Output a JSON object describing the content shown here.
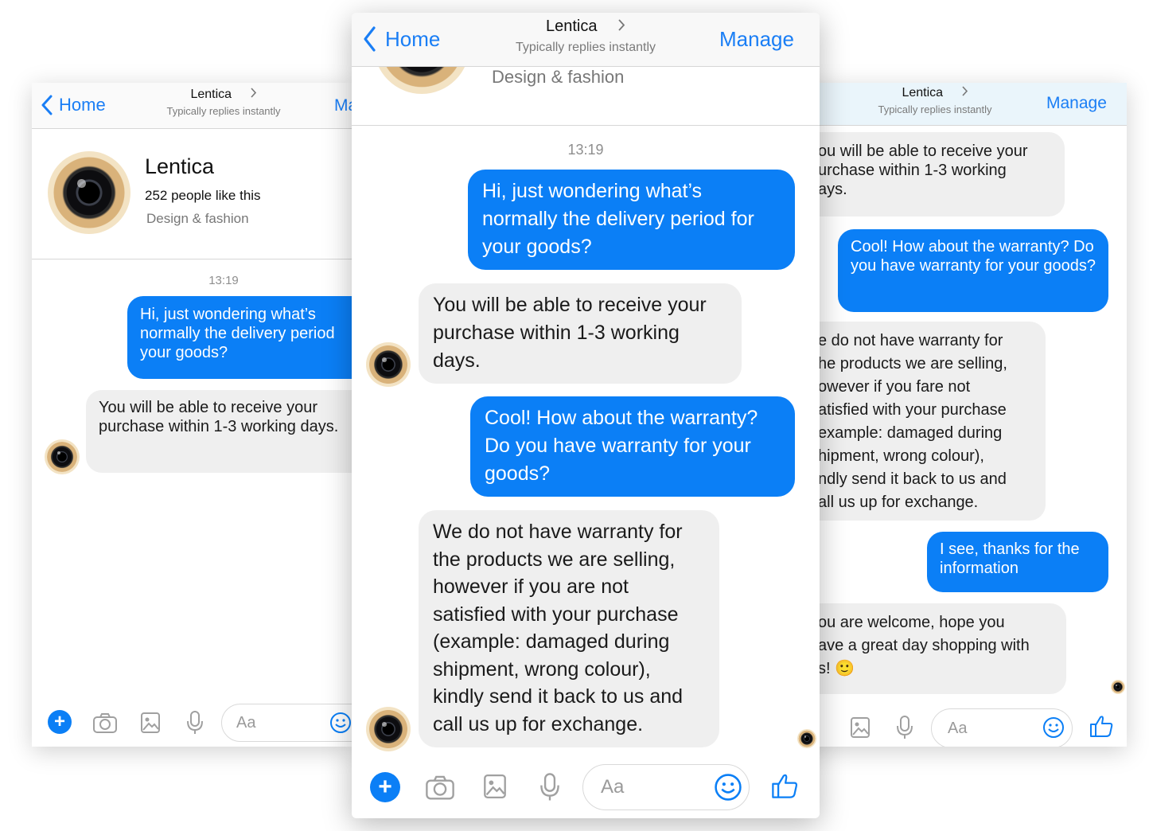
{
  "colors": {
    "accent": "#0b7ff6",
    "incoming_bubble": "#efefef",
    "nav_text": "#1a7ef5"
  },
  "chat": {
    "back_label": "Home",
    "page_name": "Lentica",
    "subtitle": "Typically replies instantly",
    "manage_label": "Manage",
    "likes": "252 people like this",
    "category": "Design & fashion",
    "timestamp": "13:19",
    "composer_placeholder": "Aa",
    "messages": [
      {
        "from": "user",
        "text": "Hi, just wondering what’s normally the delivery period for your goods?"
      },
      {
        "from": "page",
        "text": "You will be able to receive your purchase within 1-3 working days."
      },
      {
        "from": "user",
        "text": "Cool! How about the warranty? Do you have warranty for your goods?"
      },
      {
        "from": "page",
        "text": "We do not have warranty for the products we are selling, however if you  are not satisfied with your purchase (example: damaged during shipment, wrong colour), kindly send it back to us and call us up for exchange."
      },
      {
        "from": "user",
        "text": "I see, thanks for the information"
      },
      {
        "from": "page",
        "text": "You are welcome, hope you have a great day shopping with us! 🙂"
      }
    ]
  },
  "left_screen": {
    "manage_partial": "Ma",
    "msg0_visible": "Hi, just wondering what’s\nnormally the delivery period\nyour goods?"
  },
  "right_screen": {
    "msg1_visible": "ou will be able to receive your\nurchase within 1-3 working\nays.",
    "msg3_visible": "e do not have warranty for\nhe products we are selling,\nowever if you fare not\natisfied with your purchase\nexample: damaged during\nhipment, wrong colour),\nndly send it back to us and\nall us up for exchange.",
    "msg5_visible": "ou are welcome, hope you\nave a great day shopping with\ns! 🙂"
  },
  "icons": [
    "chevron-left-icon",
    "chevron-right-icon",
    "plus-icon",
    "camera-icon",
    "image-icon",
    "microphone-icon",
    "smiley-icon",
    "thumbs-up-icon"
  ]
}
